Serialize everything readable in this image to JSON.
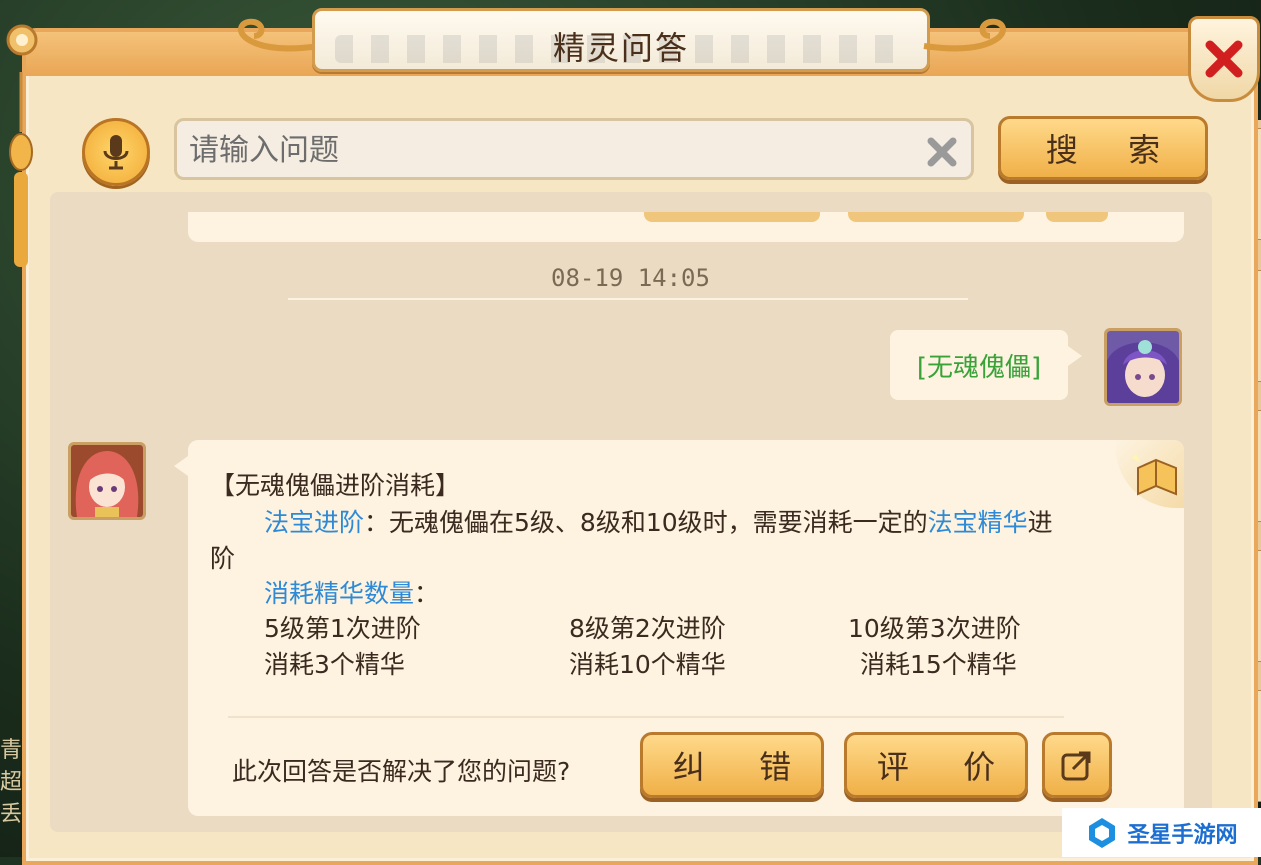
{
  "window": {
    "title": "精灵问答"
  },
  "search": {
    "placeholder": "请输入问题",
    "value": "",
    "button_label": "搜 索"
  },
  "chat": {
    "timestamp": "08-19 14:05",
    "user_message": "[无魂傀儡]",
    "answer": {
      "heading": "【无魂傀儡进阶消耗】",
      "p1_label": "法宝进阶",
      "p1_text": "：无魂傀儡在5级、8级和10级时，需要消耗一定的",
      "p1_link": "法宝精华",
      "p1_tail": "进",
      "p1_wrap": "阶",
      "p2_label": "消耗精华数量",
      "p2_colon": "：",
      "tiers": [
        {
          "level": "5级第1次进阶",
          "cost": "消耗3个精华"
        },
        {
          "level": "8级第2次进阶",
          "cost": "消耗10个精华"
        },
        {
          "level": "10级第3次进阶",
          "cost": "消耗15个精华"
        }
      ]
    },
    "feedback_question": "此次回答是否解决了您的问题?",
    "correct_button": "纠 错",
    "rate_button": "评 价"
  },
  "side": {
    "left_chars": [
      "青",
      "超",
      "丢"
    ]
  },
  "watermark": {
    "text": "圣星手游网"
  },
  "icons": {
    "mic": "microphone-icon",
    "clear": "clear-x-icon",
    "close": "close-icon",
    "share": "share-icon",
    "book": "book-icon"
  },
  "colors": {
    "accent": "#f0b048",
    "link": "#2e8ad6",
    "user_text": "#39a33a",
    "close": "#d11f1f"
  }
}
